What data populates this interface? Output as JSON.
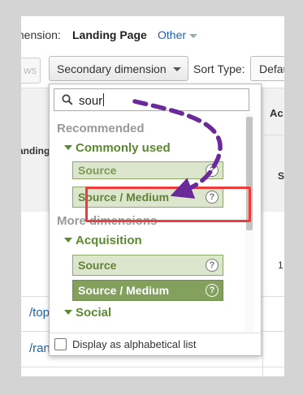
{
  "header": {
    "primary_dimension_label": "mension:",
    "primary_dimension_value": "Landing Page",
    "other_label": "Other"
  },
  "controls": {
    "ghost_button_label": "ws",
    "secondary_dimension_label": "Secondary dimension",
    "sort_type_label": "Sort Type:",
    "sort_type_value": "Defau"
  },
  "table": {
    "col_header_partial": "anding",
    "right_header_top": "Ac",
    "right_header_sub": "S",
    "rows": [
      {
        "link": "/top",
        "right": ""
      },
      {
        "link": "/ran",
        "right": ""
      }
    ],
    "right_value_1": "1"
  },
  "dropdown": {
    "search_value": "sour",
    "sections": {
      "recommended": "Recommended",
      "commonly_used": "Commonly used",
      "more_dimensions": "More dimensions",
      "acquisition": "Acquisition",
      "social": "Social"
    },
    "recommended_options": [
      {
        "label": "Source"
      },
      {
        "label": "Source / Medium"
      }
    ],
    "acquisition_options": [
      {
        "label": "Source"
      },
      {
        "label": "Source / Medium"
      }
    ],
    "help_glyph": "?",
    "alphabetical_label": "Display as alphabetical list"
  },
  "annotation": {
    "highlight_color": "#ee3b3b",
    "arrow_color": "#6a2a9a"
  }
}
